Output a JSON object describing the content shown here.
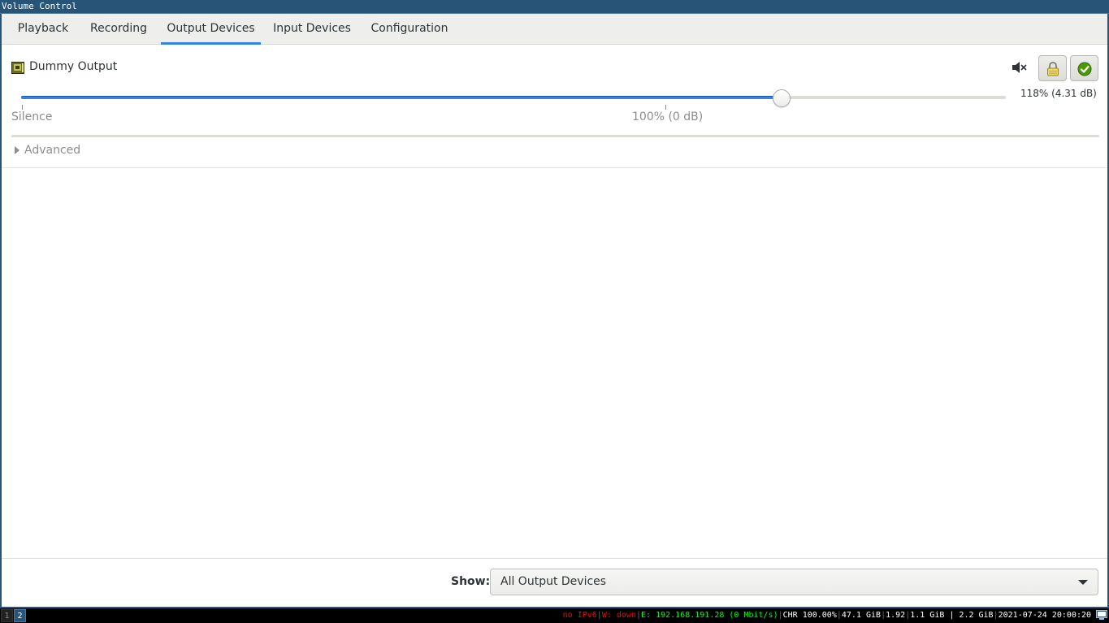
{
  "window": {
    "title": "Volume Control"
  },
  "tabs": [
    {
      "label": "Playback"
    },
    {
      "label": "Recording"
    },
    {
      "label": "Output Devices"
    },
    {
      "label": "Input Devices"
    },
    {
      "label": "Configuration"
    }
  ],
  "active_tab": "Output Devices",
  "device": {
    "name": "Dummy Output",
    "icon": "sound-card-icon",
    "volume_label": "118% (4.31 dB)",
    "volume_fraction": 0.772,
    "marks": {
      "silence": "Silence",
      "hundred": "100% (0 dB)"
    },
    "mute_icon": "speaker-muted-icon",
    "lock_icon": "lock-icon",
    "default_icon": "checkmark-icon",
    "advanced_label": "Advanced"
  },
  "bottom": {
    "show_label": "Show:",
    "show_value": "All Output Devices"
  },
  "statusbar": {
    "workspaces": [
      "1",
      "2"
    ],
    "focused_workspace": "2",
    "blocks": [
      {
        "text": "no IPv6",
        "color": "#ff0000"
      },
      {
        "text": "W: down",
        "color": "#ff0000"
      },
      {
        "text": "E: 192.168.191.28 (0 Mbit/s)",
        "color": "#00ff00"
      },
      {
        "text": "CHR 100.00%",
        "color": "#ffffff"
      },
      {
        "text": "47.1 GiB",
        "color": "#ffffff"
      },
      {
        "text": "1.92",
        "color": "#ffffff"
      },
      {
        "text": "1.1 GiB | 2.2 GiB",
        "color": "#ffffff"
      },
      {
        "text": "2021-07-24 20:00:20",
        "color": "#ffffff"
      }
    ]
  },
  "colors": {
    "accent": "#3584e4",
    "titlebar": "#285577"
  }
}
